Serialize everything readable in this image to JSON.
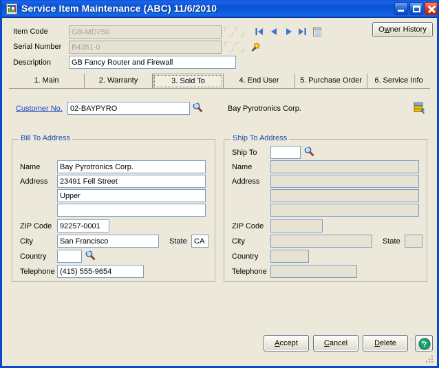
{
  "window": {
    "title": "Service Item Maintenance (ABC) 11/6/2010",
    "icon": "app-icon",
    "minimize_label": "minimize-icon",
    "maximize_label": "maximize-icon",
    "close_label": "close-icon"
  },
  "header": {
    "item_code_label": "Item Code",
    "item_code_value": "GB-MD750",
    "serial_number_label": "Serial Number",
    "serial_number_value": "B4351-0",
    "description_label": "Description",
    "description_value": "GB Fancy Router and Firewall",
    "owner_history_label": "Owner History",
    "owner_history_accesskey": "w",
    "nav": {
      "first": "nav-first-icon",
      "prev": "nav-prev-icon",
      "next": "nav-next-icon",
      "last": "nav-last-icon",
      "memo": "memo-icon"
    },
    "wand_icon": "wand-icon"
  },
  "tabs": [
    {
      "label": "1. Main",
      "accesskey": "1",
      "active": false
    },
    {
      "label": "2. Warranty",
      "accesskey": "2",
      "active": false
    },
    {
      "label": "3. Sold To",
      "accesskey": "3",
      "active": true
    },
    {
      "label": "4. End User",
      "accesskey": "4",
      "active": false
    },
    {
      "label": "5. Purchase Order",
      "accesskey": "5",
      "active": false
    },
    {
      "label": "6. Service Info",
      "accesskey": "6",
      "active": false
    }
  ],
  "sold_to": {
    "customer_no_label": "Customer No.",
    "customer_no_value": "02-BAYPYRO",
    "customer_lookup_icon": "magnifier-icon",
    "customer_name_text": "Bay Pyrotronics Corp.",
    "customer_inquiry_icon": "customer-drilldown-icon",
    "bill_to": {
      "title": "Bill To Address",
      "name_label": "Name",
      "name_value": "Bay Pyrotronics Corp.",
      "address_label": "Address",
      "address_line1": "23491 Fell Street",
      "address_line2": "Upper",
      "address_line3": "",
      "zip_label": "ZIP Code",
      "zip_value": "92257-0001",
      "city_label": "City",
      "city_value": "San Francisco",
      "state_label": "State",
      "state_value": "CA",
      "country_label": "Country",
      "country_value": "",
      "country_lookup_icon": "magnifier-icon",
      "telephone_label": "Telephone",
      "telephone_value": "(415) 555-9654"
    },
    "ship_to": {
      "title": "Ship To Address",
      "ship_to_label": "Ship To",
      "ship_to_value": "",
      "ship_to_lookup_icon": "magnifier-icon",
      "name_label": "Name",
      "name_value": "",
      "address_label": "Address",
      "address_line1": "",
      "address_line2": "",
      "address_line3": "",
      "zip_label": "ZIP Code",
      "zip_value": "",
      "city_label": "City",
      "city_value": "",
      "state_label": "State",
      "state_value": "",
      "country_label": "Country",
      "country_value": "",
      "telephone_label": "Telephone",
      "telephone_value": ""
    }
  },
  "footer": {
    "accept_label": "Accept",
    "accept_accesskey": "A",
    "cancel_label": "Cancel",
    "cancel_accesskey": "C",
    "delete_label": "Delete",
    "delete_accesskey": "D",
    "extra_button": "",
    "help_icon": "help-icon",
    "resize_grip": "resize-grip"
  },
  "colors": {
    "titlebar": "#0A52D4",
    "window_bg": "#ECE9DB",
    "field_border": "#7B9EC4",
    "field_bg": "#FFFFFF",
    "field_disabled_bg": "#E6E3D4",
    "group_title": "#1B4EA8",
    "link": "#1B3FC0"
  }
}
